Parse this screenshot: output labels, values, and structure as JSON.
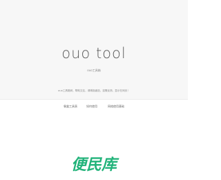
{
  "header": {
    "title": "ouo tool",
    "subtitle": "ouo工具箱"
  },
  "intro": {
    "text": "ouo工具箱网，帮助交友，请精挑细选，如需反馈，显示在网页！"
  },
  "nav": {
    "links": [
      {
        "label": "餐盒工具表"
      },
      {
        "label": "如何使用"
      },
      {
        "label": "网络使用基础"
      }
    ]
  },
  "footer": {
    "logo_text": "便民库",
    "logo_color": "#22b37a"
  }
}
